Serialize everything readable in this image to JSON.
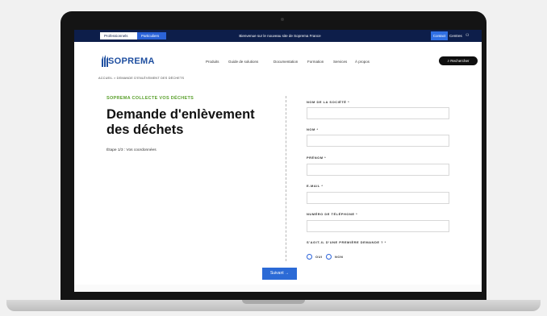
{
  "topbar": {
    "tab_professionnels": "Professionnels",
    "tab_particuliers": "Particuliers",
    "message": "Bienvenue sur le nouveau site de Soprema France",
    "contact": "Contact",
    "centres": "Centres",
    "user_icon": "user-icon"
  },
  "header": {
    "logo_text": "SOPREMA",
    "nav": [
      "Produits",
      "Guide de solutions",
      "Documentation",
      "Formation",
      "Services",
      "À propos"
    ],
    "search_label": "Rechercher"
  },
  "breadcrumb": "ACCUEIL  >  DEMANDE D'ENLÈVEMENT DES DÉCHETS",
  "intro": {
    "kicker": "SOPREMA COLLECTE VOS DÉCHETS",
    "title": "Demande d'enlèvement des déchets",
    "step": "Étape 1/3 : Vos coordonnées"
  },
  "form": {
    "company_label": "NOM DE LA SOCIÉTÉ *",
    "name_label": "NOM *",
    "firstname_label": "PRÉNOM *",
    "email_label": "E-MAIL *",
    "phone_label": "NUMÉRO DE TÉLÉPHONE *",
    "first_request_label": "S'AGIT-IL D'UNE PREMIÈRE DEMANDE ? *",
    "yes": "OUI",
    "no": "NON",
    "next_button": "Suivant →"
  },
  "colors": {
    "navy": "#0d1e4a",
    "blue": "#2b63d9",
    "green": "#5aa02c",
    "logo_blue": "#1f4fa0"
  }
}
